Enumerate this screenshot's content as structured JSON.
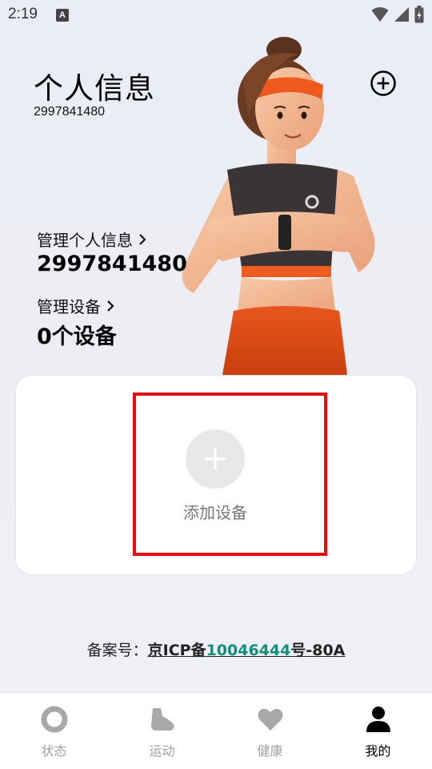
{
  "status_bar": {
    "time": "2:19",
    "notification_glyph": "A",
    "icons": [
      "wifi-icon",
      "signal-icon",
      "battery-icon"
    ]
  },
  "header": {
    "title": "个人信息",
    "user_id": "2997841480",
    "add_icon": "add-circle-icon"
  },
  "profile": {
    "manage_info_label": "管理个人信息",
    "manage_info_value": "2997841480",
    "manage_device_label": "管理设备",
    "manage_device_value": "0个设备",
    "chevron_icon": "chevron-right-icon"
  },
  "device_card": {
    "add_label": "添加设备",
    "add_icon": "plus-icon",
    "highlight_color": "#e01010"
  },
  "footer": {
    "icp_prefix": "备案号：",
    "icp_part1": "京ICP备",
    "icp_number": "10046444",
    "icp_part2": "号-80A",
    "icp_number_color": "#10907a"
  },
  "tabs": [
    {
      "label": "状态",
      "icon": "status-ring-icon",
      "active": false
    },
    {
      "label": "运动",
      "icon": "shoe-icon",
      "active": false
    },
    {
      "label": "健康",
      "icon": "heart-icon",
      "active": false
    },
    {
      "label": "我的",
      "icon": "person-icon",
      "active": true
    }
  ]
}
